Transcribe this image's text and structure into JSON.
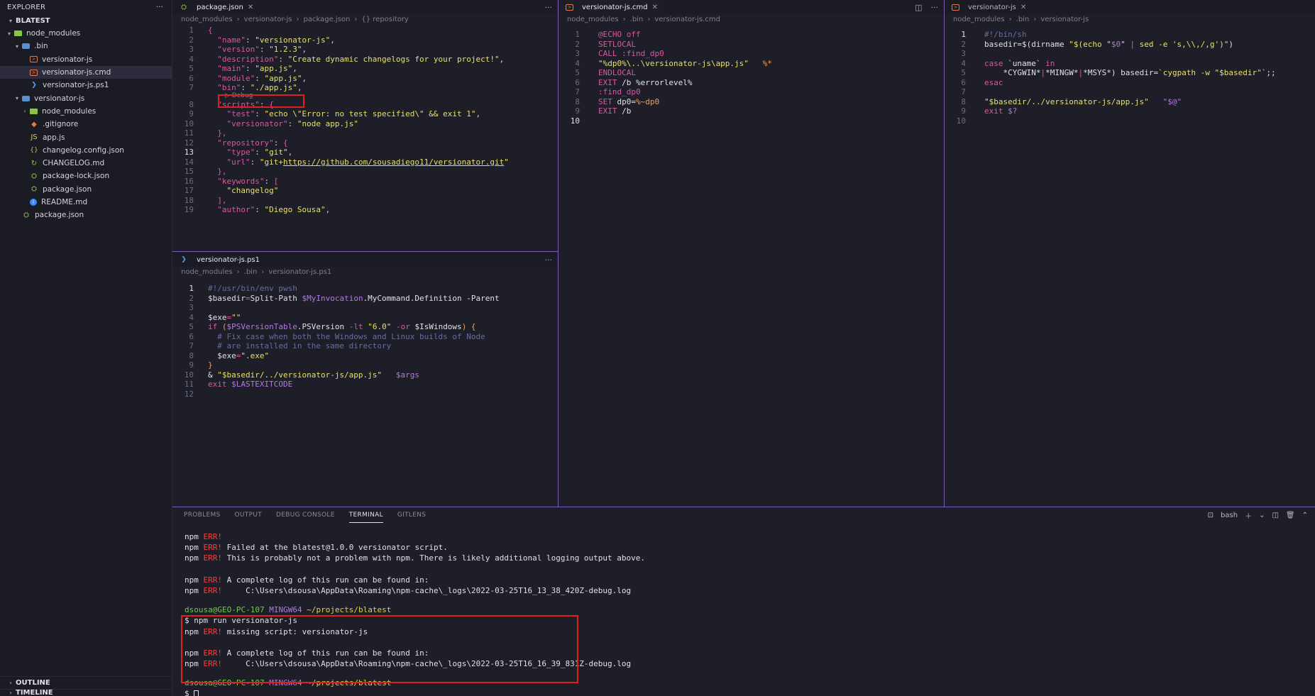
{
  "sidebar": {
    "title": "EXPLORER",
    "more": "···",
    "workspace": "BLATEST",
    "items": [
      {
        "label": "node_modules",
        "depth": 0,
        "kind": "folder-open"
      },
      {
        "label": ".bin",
        "depth": 1,
        "kind": "folderb-open"
      },
      {
        "label": "versionator-js",
        "depth": 2,
        "kind": "cmd"
      },
      {
        "label": "versionator-js.cmd",
        "depth": 2,
        "kind": "cmd"
      },
      {
        "label": "versionator-js.ps1",
        "depth": 2,
        "kind": "ps"
      },
      {
        "label": "versionator-js",
        "depth": 1,
        "kind": "folderb-open"
      },
      {
        "label": "node_modules",
        "depth": 2,
        "kind": "folder-closed"
      },
      {
        "label": ".gitignore",
        "depth": 2,
        "kind": "git"
      },
      {
        "label": "app.js",
        "depth": 2,
        "kind": "js"
      },
      {
        "label": "changelog.config.json",
        "depth": 2,
        "kind": "json"
      },
      {
        "label": "CHANGELOG.md",
        "depth": 2,
        "kind": "chg"
      },
      {
        "label": "package-lock.json",
        "depth": 2,
        "kind": "pkg"
      },
      {
        "label": "package.json",
        "depth": 2,
        "kind": "pkg"
      },
      {
        "label": "README.md",
        "depth": 2,
        "kind": "info"
      },
      {
        "label": "package.json",
        "depth": 1,
        "kind": "pkg"
      }
    ],
    "selected_index": 3,
    "outline": "OUTLINE",
    "timeline": "TIMELINE"
  },
  "editor1": {
    "tab": "package.json",
    "breadcrumb": [
      "node_modules",
      "versionator-js",
      "package.json",
      "{} repository"
    ],
    "codelens": "▷ Debug",
    "lines": [
      {
        "n": "1",
        "t": [
          [
            "{",
            "k"
          ]
        ]
      },
      {
        "n": "2",
        "t": [
          [
            "  \"name\"",
            "k"
          ],
          [
            ": ",
            "p"
          ],
          [
            "\"versionator-js\"",
            "s"
          ],
          [
            ",",
            "p"
          ]
        ]
      },
      {
        "n": "3",
        "t": [
          [
            "  \"version\"",
            "k"
          ],
          [
            ": ",
            "p"
          ],
          [
            "\"1.2.3\"",
            "s"
          ],
          [
            ",",
            "p"
          ]
        ]
      },
      {
        "n": "4",
        "t": [
          [
            "  \"description\"",
            "k"
          ],
          [
            ": ",
            "p"
          ],
          [
            "\"Create dynamic changelogs for your project!\"",
            "s"
          ],
          [
            ",",
            "p"
          ]
        ]
      },
      {
        "n": "5",
        "t": [
          [
            "  \"main\"",
            "k"
          ],
          [
            ": ",
            "p"
          ],
          [
            "\"app.js\"",
            "s"
          ],
          [
            ",",
            "p"
          ]
        ]
      },
      {
        "n": "6",
        "t": [
          [
            "  \"module\"",
            "k"
          ],
          [
            ": ",
            "p"
          ],
          [
            "\"app.js\"",
            "s"
          ],
          [
            ",",
            "p"
          ]
        ]
      },
      {
        "n": "7",
        "t": [
          [
            "  \"bin\"",
            "k"
          ],
          [
            ": ",
            "p"
          ],
          [
            "\"./app.js\"",
            "s"
          ],
          [
            ",",
            "p"
          ]
        ]
      },
      {
        "n": "8",
        "t": [
          [
            "  \"scripts\"",
            "k"
          ],
          [
            ": ",
            "p"
          ],
          [
            "{",
            "k"
          ]
        ]
      },
      {
        "n": "9",
        "t": [
          [
            "    \"test\"",
            "k"
          ],
          [
            ": ",
            "p"
          ],
          [
            "\"echo \\\"Error: no test specified\\\" && exit 1\"",
            "s"
          ],
          [
            ",",
            "p"
          ]
        ]
      },
      {
        "n": "10",
        "t": [
          [
            "    \"versionator\"",
            "k"
          ],
          [
            ": ",
            "p"
          ],
          [
            "\"node app.js\"",
            "s"
          ]
        ]
      },
      {
        "n": "11",
        "t": [
          [
            "  },",
            "k"
          ]
        ]
      },
      {
        "n": "12",
        "t": [
          [
            "  \"repository\"",
            "k"
          ],
          [
            ": ",
            "p"
          ],
          [
            "{",
            "k"
          ]
        ]
      },
      {
        "n": "13",
        "t": [
          [
            "    \"type\"",
            "k"
          ],
          [
            ": ",
            "p"
          ],
          [
            "\"git\"",
            "s"
          ],
          [
            ",",
            "p"
          ]
        ]
      },
      {
        "n": "14",
        "t": [
          [
            "    \"url\"",
            "k"
          ],
          [
            ": ",
            "p"
          ],
          [
            "\"git+",
            "s"
          ],
          [
            "https://github.com/sousadiego11/versionator.git",
            "u"
          ],
          [
            "\"",
            "s"
          ]
        ]
      },
      {
        "n": "15",
        "t": [
          [
            "  },",
            "k"
          ]
        ]
      },
      {
        "n": "16",
        "t": [
          [
            "  \"keywords\"",
            "k"
          ],
          [
            ": ",
            "p"
          ],
          [
            "[",
            "k"
          ]
        ]
      },
      {
        "n": "17",
        "t": [
          [
            "    \"changelog\"",
            "s"
          ]
        ]
      },
      {
        "n": "18",
        "t": [
          [
            "  ],",
            "k"
          ]
        ]
      },
      {
        "n": "19",
        "t": [
          [
            "  \"author\"",
            "k"
          ],
          [
            ": ",
            "p"
          ],
          [
            "\"Diego Sousa\"",
            "s"
          ],
          [
            ",",
            "p"
          ]
        ]
      }
    ]
  },
  "editor2": {
    "tab": "versionator-js.ps1",
    "breadcrumb": [
      "node_modules",
      ".bin",
      "versionator-js.ps1"
    ],
    "lines": [
      {
        "n": "1",
        "t": [
          [
            "#!/usr/bin/env pwsh",
            "c"
          ]
        ]
      },
      {
        "n": "2",
        "t": [
          [
            "$basedir",
            "w"
          ],
          [
            "=",
            "k"
          ],
          [
            "Split-Path ",
            "w"
          ],
          [
            "$MyInvocation",
            "v"
          ],
          [
            ".MyCommand.Definition ",
            "w"
          ],
          [
            "-Parent",
            "w"
          ]
        ]
      },
      {
        "n": "3",
        "t": []
      },
      {
        "n": "4",
        "t": [
          [
            "$exe",
            "w"
          ],
          [
            "=",
            "k"
          ],
          [
            "\"\"",
            "s"
          ]
        ]
      },
      {
        "n": "5",
        "t": [
          [
            "if ",
            "k"
          ],
          [
            "(",
            "o"
          ],
          [
            "$PSVersionTable",
            "v"
          ],
          [
            ".PSVersion ",
            "w"
          ],
          [
            "-lt ",
            "k"
          ],
          [
            "\"6.0\" ",
            "s"
          ],
          [
            "-or ",
            "k"
          ],
          [
            "$IsWindows",
            "w"
          ],
          [
            ") {",
            "o"
          ]
        ]
      },
      {
        "n": "6",
        "t": [
          [
            "  # Fix case when both the Windows and Linux builds of Node",
            "c"
          ]
        ]
      },
      {
        "n": "7",
        "t": [
          [
            "  # are installed in the same directory",
            "c"
          ]
        ]
      },
      {
        "n": "8",
        "t": [
          [
            "  $exe",
            "w"
          ],
          [
            "=",
            "k"
          ],
          [
            "\".exe\"",
            "s"
          ]
        ]
      },
      {
        "n": "9",
        "t": [
          [
            "}",
            "o"
          ]
        ]
      },
      {
        "n": "10",
        "t": [
          [
            "& ",
            "w"
          ],
          [
            "\"$basedir/../versionator-js/app.js\"",
            "s"
          ],
          [
            "   ",
            "p"
          ],
          [
            "$args",
            "v"
          ]
        ]
      },
      {
        "n": "11",
        "t": [
          [
            "exit ",
            "k"
          ],
          [
            "$LASTEXITCODE",
            "v"
          ]
        ]
      },
      {
        "n": "12",
        "t": []
      }
    ]
  },
  "editor3": {
    "tab": "versionator-js.cmd",
    "breadcrumb": [
      "node_modules",
      ".bin",
      "versionator-js.cmd"
    ],
    "lines": [
      {
        "n": "1",
        "t": [
          [
            "@ECHO off",
            "k"
          ]
        ]
      },
      {
        "n": "2",
        "t": [
          [
            "SETLOCAL",
            "k"
          ]
        ]
      },
      {
        "n": "3",
        "t": [
          [
            "CALL ",
            "k"
          ],
          [
            ":find_dp0",
            "k"
          ]
        ]
      },
      {
        "n": "4",
        "t": [
          [
            "\"%dp0%\\..\\versionator-js\\app.js\"",
            "s"
          ],
          [
            "   %*",
            "o"
          ]
        ]
      },
      {
        "n": "5",
        "t": [
          [
            "ENDLOCAL",
            "k"
          ]
        ]
      },
      {
        "n": "6",
        "t": [
          [
            "EXIT ",
            "k"
          ],
          [
            "/b %errorlevel%",
            "w"
          ]
        ]
      },
      {
        "n": "7",
        "t": [
          [
            ":find_dp0",
            "k"
          ]
        ]
      },
      {
        "n": "8",
        "t": [
          [
            "SET ",
            "k"
          ],
          [
            "dp0",
            "w"
          ],
          [
            "=",
            "w"
          ],
          [
            "%~dp0",
            "o"
          ]
        ]
      },
      {
        "n": "9",
        "t": [
          [
            "EXIT ",
            "k"
          ],
          [
            "/b",
            "w"
          ]
        ]
      },
      {
        "n": "10",
        "t": []
      }
    ]
  },
  "editor4": {
    "tab": "versionator-js",
    "breadcrumb": [
      "node_modules",
      ".bin",
      "versionator-js"
    ],
    "lines": [
      {
        "n": "1",
        "t": [
          [
            "#!/bin/sh",
            "c"
          ]
        ]
      },
      {
        "n": "2",
        "t": [
          [
            "basedir",
            "w"
          ],
          [
            "=$(dirname ",
            "w"
          ],
          [
            "\"$(echo \"",
            "s"
          ],
          [
            "$0",
            "v"
          ],
          [
            "\" ",
            "s"
          ],
          [
            "| ",
            "k"
          ],
          [
            "sed -e 's,\\\\,/,g')\"",
            "s"
          ],
          [
            ")",
            "w"
          ]
        ]
      },
      {
        "n": "3",
        "t": []
      },
      {
        "n": "4",
        "t": [
          [
            "case ",
            "k"
          ],
          [
            "`uname` ",
            "w"
          ],
          [
            "in",
            "k"
          ]
        ]
      },
      {
        "n": "5",
        "t": [
          [
            "    *CYGWIN*",
            "w"
          ],
          [
            "|",
            "k"
          ],
          [
            "*MINGW*",
            "w"
          ],
          [
            "|",
            "k"
          ],
          [
            "*MSYS*",
            "w"
          ],
          [
            ") basedir=",
            "w"
          ],
          [
            "`cygpath -w \"$basedir\"`",
            "s"
          ],
          [
            ";;",
            "w"
          ]
        ]
      },
      {
        "n": "6",
        "t": [
          [
            "esac",
            "k"
          ]
        ]
      },
      {
        "n": "7",
        "t": []
      },
      {
        "n": "8",
        "t": [
          [
            "\"$basedir/../versionator-js/app.js\"",
            "s"
          ],
          [
            "   ",
            "p"
          ],
          [
            "\"$@\"",
            "v"
          ]
        ]
      },
      {
        "n": "9",
        "t": [
          [
            "exit ",
            "k"
          ],
          [
            "$?",
            "v"
          ]
        ]
      },
      {
        "n": "10",
        "t": []
      }
    ]
  },
  "panel": {
    "tabs": [
      "PROBLEMS",
      "OUTPUT",
      "DEBUG CONSOLE",
      "TERMINAL",
      "GITLENS"
    ],
    "active_tab": "TERMINAL",
    "shell": "bash",
    "terminal": [
      [
        [
          "npm ",
          "w"
        ],
        [
          "ERR!",
          "err"
        ]
      ],
      [
        [
          "npm ",
          "w"
        ],
        [
          "ERR!",
          "err"
        ],
        [
          " Failed at the blatest@1.0.0 versionator script.",
          "w"
        ]
      ],
      [
        [
          "npm ",
          "w"
        ],
        [
          "ERR!",
          "err"
        ],
        [
          " This is probably not a problem with npm. There is likely additional logging output above.",
          "w"
        ]
      ],
      [],
      [
        [
          "npm ",
          "w"
        ],
        [
          "ERR!",
          "err"
        ],
        [
          " A complete log of this run can be found in:",
          "w"
        ]
      ],
      [
        [
          "npm ",
          "w"
        ],
        [
          "ERR!",
          "err"
        ],
        [
          "     C:\\Users\\dsousa\\AppData\\Roaming\\npm-cache\\_logs\\2022-03-25T16_13_38_420Z-debug.log",
          "w"
        ]
      ],
      [],
      [
        [
          "dsousa@GEO-PC-107 ",
          "green"
        ],
        [
          "MINGW64 ",
          "purple"
        ],
        [
          "~/projects/blatest",
          "yel"
        ]
      ],
      [
        [
          "$ npm run versionator-js",
          "w"
        ]
      ],
      [
        [
          "npm ",
          "w"
        ],
        [
          "ERR!",
          "err"
        ],
        [
          " missing script: versionator-js",
          "w"
        ]
      ],
      [],
      [
        [
          "npm ",
          "w"
        ],
        [
          "ERR!",
          "err"
        ],
        [
          " A complete log of this run can be found in:",
          "w"
        ]
      ],
      [
        [
          "npm ",
          "w"
        ],
        [
          "ERR!",
          "err"
        ],
        [
          "     C:\\Users\\dsousa\\AppData\\Roaming\\npm-cache\\_logs\\2022-03-25T16_16_39_831Z-debug.log",
          "w"
        ]
      ],
      [],
      [
        [
          "dsousa@GEO-PC-107 ",
          "green"
        ],
        [
          "MINGW64 ",
          "purple"
        ],
        [
          "~/projects/blatest",
          "yel"
        ]
      ],
      [
        [
          "$ ",
          "w"
        ]
      ]
    ]
  }
}
